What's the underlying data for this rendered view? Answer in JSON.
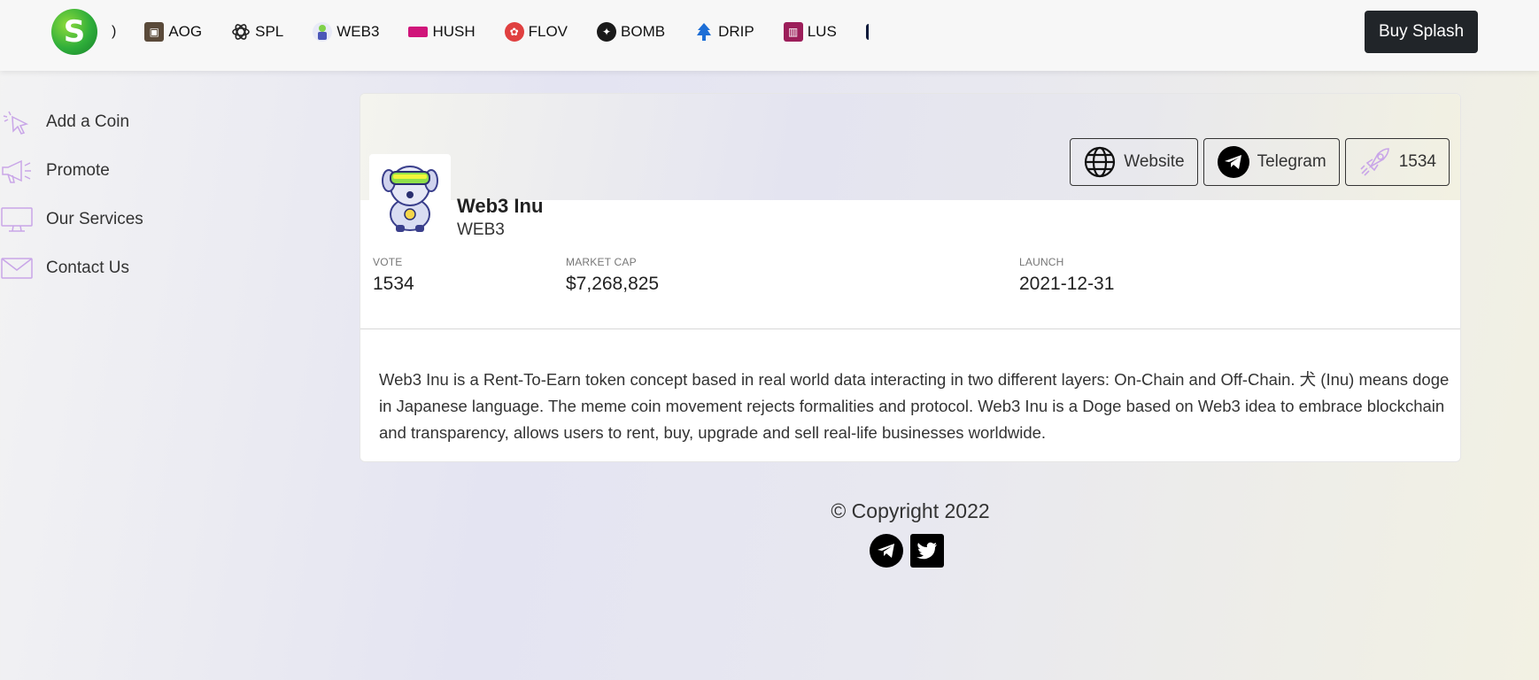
{
  "topbar": {
    "logo_letter": "S",
    "ticker_edge": ")",
    "ticker": [
      {
        "symbol": "AOG",
        "icon": "aog-icon",
        "color": "#5a4a3a"
      },
      {
        "symbol": "SPL",
        "icon": "spl-icon",
        "color": "#222222"
      },
      {
        "symbol": "WEB3",
        "icon": "web3-icon",
        "color": "#4b57b8"
      },
      {
        "symbol": "HUSH",
        "icon": "hush-icon",
        "color": "#d0157a"
      },
      {
        "symbol": "FLOV",
        "icon": "flov-icon",
        "color": "#e04040"
      },
      {
        "symbol": "BOMB",
        "icon": "bomb-icon",
        "color": "#3a3a3a"
      },
      {
        "symbol": "DRIP",
        "icon": "drip-icon",
        "color": "#1d6ed6"
      },
      {
        "symbol": "LUS",
        "icon": "lus-icon",
        "color": "#9c1e5a"
      }
    ],
    "buy_label": "Buy Splash"
  },
  "sidebar": {
    "items": [
      {
        "label": "Add a Coin",
        "icon": "cursor-click-icon"
      },
      {
        "label": "Promote",
        "icon": "megaphone-icon"
      },
      {
        "label": "Our Services",
        "icon": "monitor-icon"
      },
      {
        "label": "Contact Us",
        "icon": "envelope-icon"
      }
    ]
  },
  "coin": {
    "name": "Web3 Inu",
    "symbol": "WEB3",
    "links": {
      "website": "Website",
      "telegram": "Telegram",
      "votes": "1534"
    },
    "stats": {
      "vote_label": "VOTE",
      "vote_value": "1534",
      "mcap_label": "MARKET CAP",
      "mcap_value": "$7,268,825",
      "launch_label": "LAUNCH",
      "launch_value": "2021-12-31"
    },
    "description": "Web3 Inu is a Rent-To-Earn token concept based in real world data interacting in two different layers: On-Chain and Off-Chain. 犬 (Inu) means doge in Japanese language. The meme coin movement rejects formalities and protocol. Web3 Inu is a Doge based on Web3 idea to embrace blockchain and transparency, allows users to rent, buy, upgrade and sell real-life businesses worldwide."
  },
  "footer": {
    "copyright": "© Copyright 2022"
  },
  "colors": {
    "accent_dark": "#212529",
    "sidebar_icon": "#c9a6e8"
  }
}
